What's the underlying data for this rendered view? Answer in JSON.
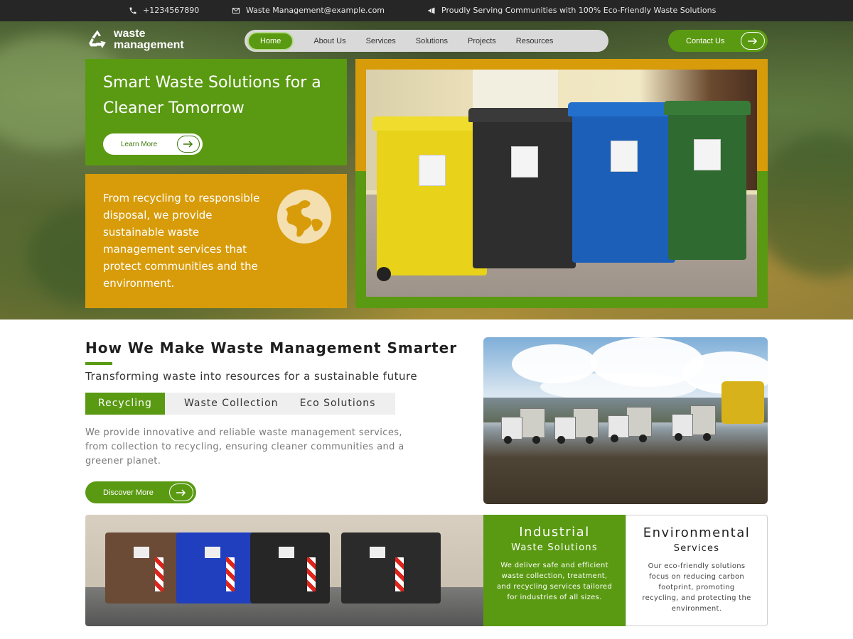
{
  "topbar": {
    "phone": "+1234567890",
    "email": "Waste Management@example.com",
    "announcement": "Proudly Serving Communities with 100% Eco-Friendly Waste Solutions"
  },
  "brand": {
    "line1": "waste",
    "line2": "management"
  },
  "nav": {
    "items": [
      "Home",
      "About Us",
      "Services",
      "Solutions",
      "Projects",
      "Resources"
    ],
    "active": "Home"
  },
  "contact_button": "Contact Us",
  "hero": {
    "title": "Smart Waste Solutions for a Cleaner Tomorrow",
    "learn_more": "Learn More",
    "description": "From recycling to responsible disposal, we provide sustainable waste management services that protect communities and the environment."
  },
  "section": {
    "title": "How We Make Waste Management Smarter",
    "subtitle": "Transforming waste into resources for a sustainable future",
    "tabs": [
      "Recycling",
      "Waste Collection",
      "Eco Solutions"
    ],
    "active_tab": "Recycling",
    "body": "We provide innovative and reliable waste management services, from collection to recycling, ensuring cleaner communities and a greener planet.",
    "discover": "Discover More"
  },
  "cards": [
    {
      "title": "Industrial",
      "subtitle": "Waste Solutions",
      "text": "We deliver safe and efficient waste collection, treatment, and recycling services tailored for industries of all sizes."
    },
    {
      "title": "Environmental",
      "subtitle": "Services",
      "text": "Our eco-friendly solutions focus on reducing carbon footprint, promoting recycling, and protecting the environment."
    }
  ],
  "colors": {
    "green": "#5a9a12",
    "orange": "#d89c0a",
    "dark": "#262626"
  },
  "icons": [
    "phone-icon",
    "mail-icon",
    "megaphone-icon",
    "recycle-logo-icon",
    "arrow-right-icon",
    "globe-icon"
  ]
}
